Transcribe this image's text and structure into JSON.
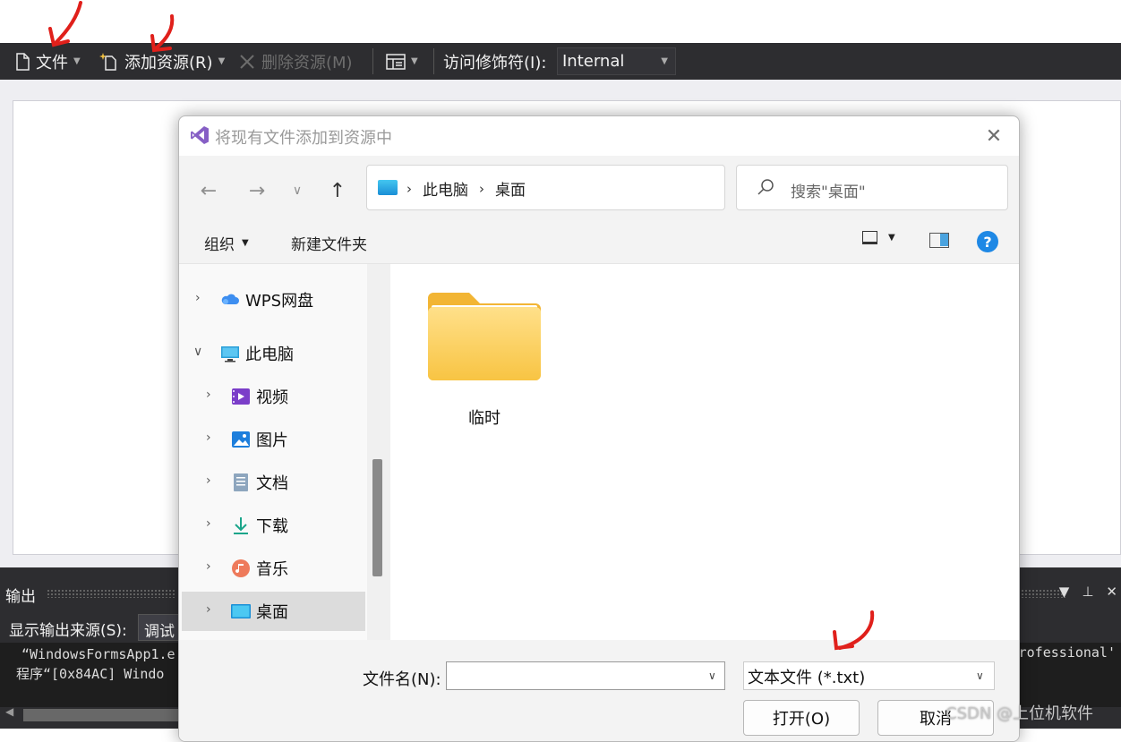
{
  "ide": {
    "toolbar": {
      "file_label": "文件",
      "add_resource_label": "添加资源(R)",
      "remove_resource_label": "删除资源(M)",
      "access_modifier_label": "访问修饰符(I):",
      "access_modifier_value": "Internal"
    },
    "output": {
      "title": "输出",
      "source_label": "显示输出来源(S):",
      "source_value": "调试",
      "lines": [
        "“WindowsFormsApp1.e",
        "程序“[0x84AC] Windo"
      ],
      "right_fragment": "Professional'"
    }
  },
  "dialog": {
    "title": "将现有文件添加到资源中",
    "breadcrumbs": [
      "此电脑",
      "桌面"
    ],
    "search_placeholder": "搜索\"桌面\"",
    "organize_label": "组织",
    "new_folder_label": "新建文件夹",
    "help_label": "?",
    "tree": [
      {
        "label": "WPS网盘",
        "icon": "cloud-icon",
        "expanded": false
      },
      {
        "label": "此电脑",
        "icon": "computer-icon",
        "expanded": true
      },
      {
        "label": "视频",
        "icon": "video-icon",
        "expanded": false
      },
      {
        "label": "图片",
        "icon": "pictures-icon",
        "expanded": false
      },
      {
        "label": "文档",
        "icon": "documents-icon",
        "expanded": false
      },
      {
        "label": "下载",
        "icon": "download-icon",
        "expanded": false
      },
      {
        "label": "音乐",
        "icon": "music-icon",
        "expanded": false
      },
      {
        "label": "桌面",
        "icon": "desktop-icon",
        "expanded": false,
        "selected": true
      }
    ],
    "folder": {
      "name": "临时",
      "icon": "folder-icon"
    },
    "filename_label": "文件名(N):",
    "filename_value": "",
    "filetype_value": "文本文件 (*.txt)",
    "open_button": "打开(O)",
    "cancel_button": "取消"
  },
  "watermark": "CSDN @上位机软件",
  "colors": {
    "toolbar_bg": "#2d2d30",
    "annotation_red": "#e0201b",
    "vs_purple": "#865fc5"
  }
}
